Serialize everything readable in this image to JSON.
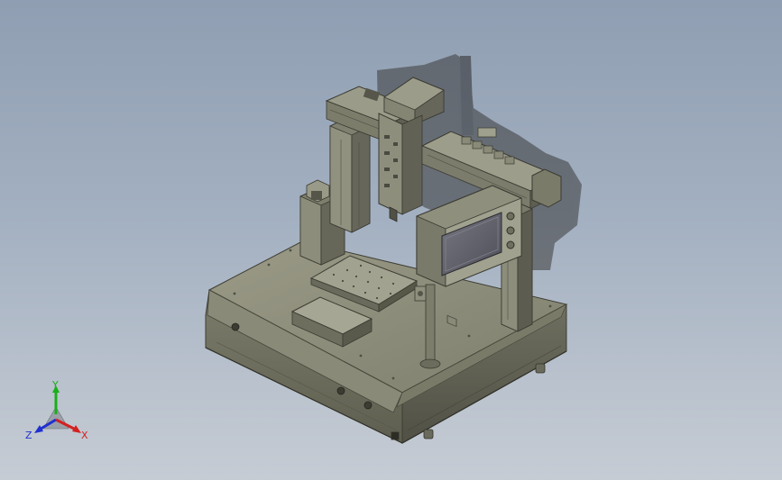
{
  "scene": {
    "background_top": "#8f9eb2",
    "background_bottom": "#c6ccd4",
    "model_body_color": "#8a8a78",
    "model_dark_color": "#5f5f52",
    "model_light_color": "#a6a693",
    "screen_color": "#60606a"
  },
  "triad": {
    "x_label": "X",
    "y_label": "Y",
    "z_label": "Z",
    "x_color": "#d42020",
    "y_color": "#18b018",
    "z_color": "#2030d0"
  }
}
